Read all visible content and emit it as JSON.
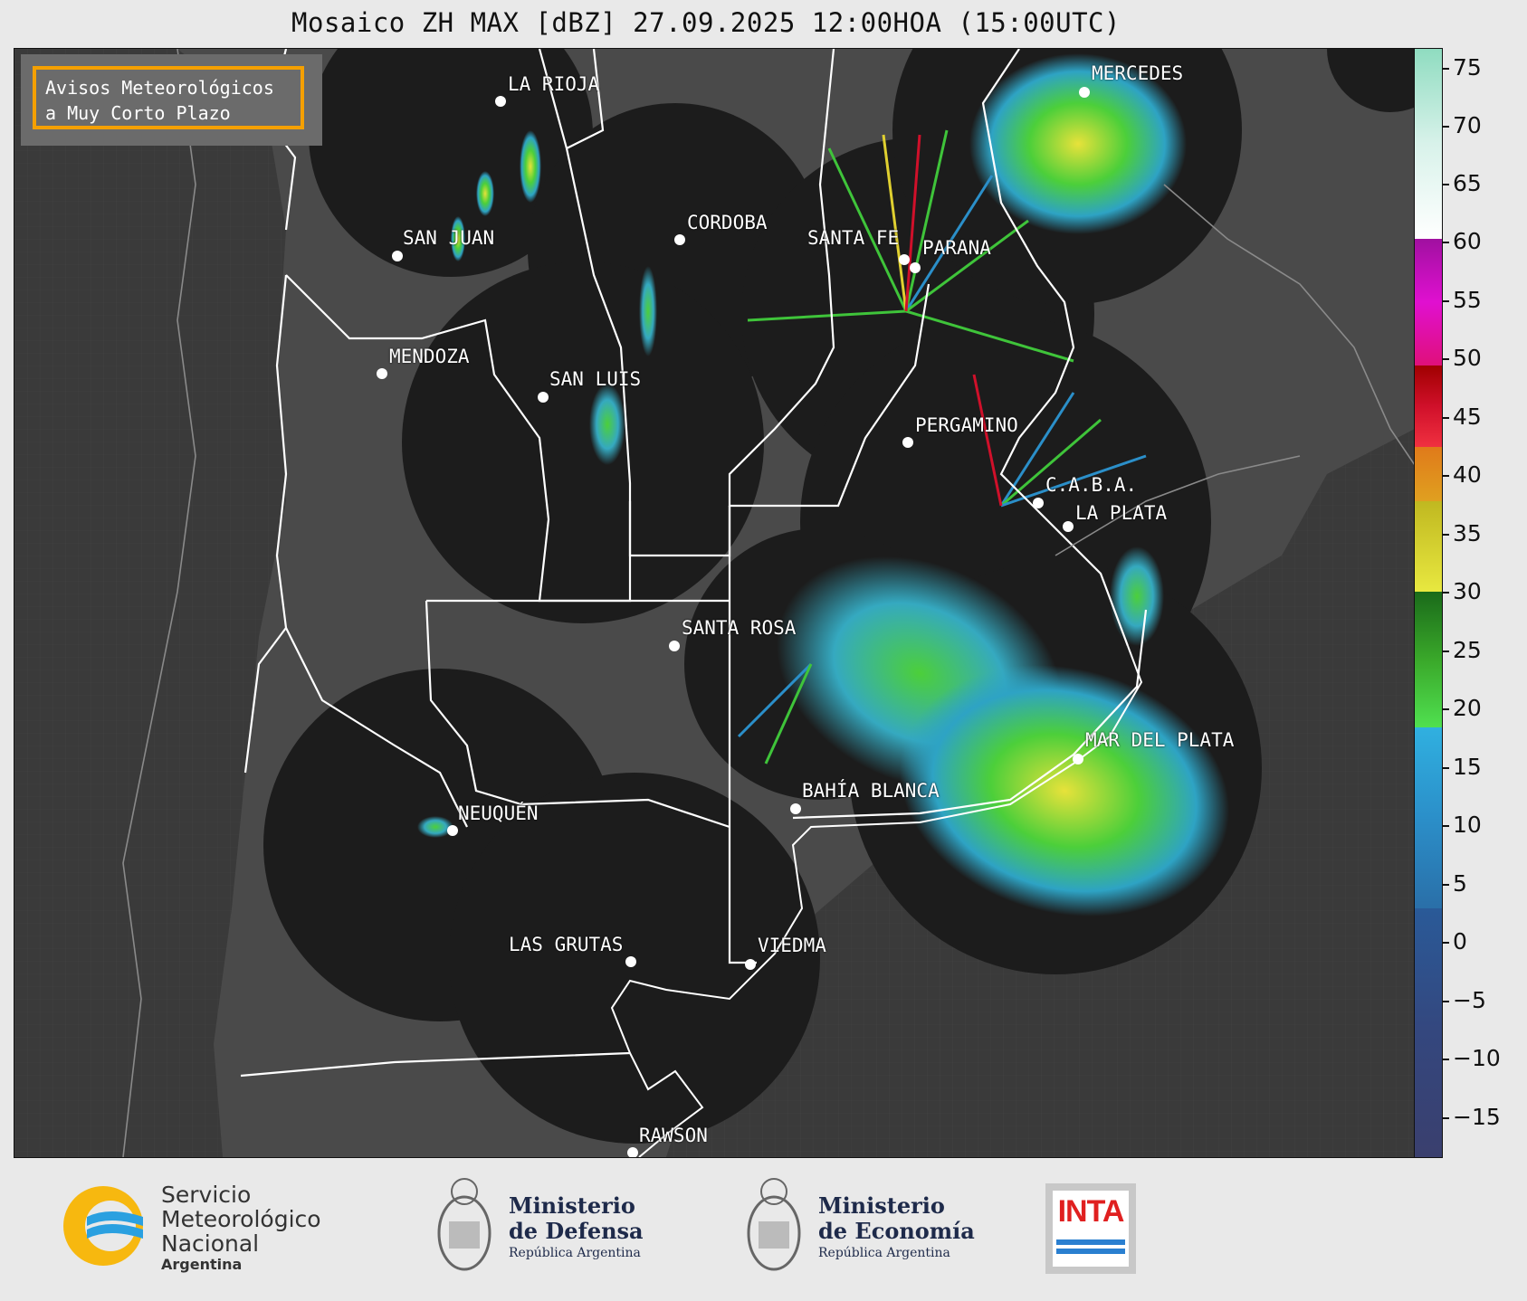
{
  "title": "Mosaico ZH MAX [dBZ] 27.09.2025 12:00HOA (15:00UTC)",
  "notice": {
    "line1": "Avisos Meteorológicos",
    "line2": "a Muy Corto Plazo"
  },
  "cities": [
    {
      "id": "la-rioja",
      "name": "LA RIOJA"
    },
    {
      "id": "cordoba",
      "name": "CORDOBA"
    },
    {
      "id": "san-juan",
      "name": "SAN JUAN"
    },
    {
      "id": "santa-fe",
      "name": "SANTA FE"
    },
    {
      "id": "parana",
      "name": "PARANA"
    },
    {
      "id": "mercedes",
      "name": "MERCEDES"
    },
    {
      "id": "mendoza",
      "name": "MENDOZA"
    },
    {
      "id": "san-luis",
      "name": "SAN LUIS"
    },
    {
      "id": "pergamino",
      "name": "PERGAMINO"
    },
    {
      "id": "caba",
      "name": "C.A.B.A."
    },
    {
      "id": "la-plata",
      "name": "LA PLATA"
    },
    {
      "id": "santa-rosa",
      "name": "SANTA ROSA"
    },
    {
      "id": "mar-del-plata",
      "name": "MAR DEL PLATA"
    },
    {
      "id": "bahia-blanca",
      "name": "BAHÍA BLANCA"
    },
    {
      "id": "neuquen",
      "name": "NEUQUÉN"
    },
    {
      "id": "las-grutas",
      "name": "LAS GRUTAS"
    },
    {
      "id": "viedma",
      "name": "VIEDMA"
    },
    {
      "id": "rawson",
      "name": "RAWSON"
    }
  ],
  "colorbar": {
    "ticks": [
      "75",
      "70",
      "65",
      "60",
      "55",
      "50",
      "45",
      "40",
      "35",
      "30",
      "25",
      "20",
      "15",
      "10",
      "5",
      "0",
      "−5",
      "−10",
      "−15"
    ],
    "colors": {
      "low": "#3a3f6e",
      "blue": "#2b8fc9",
      "green": "#3fc43a",
      "yellow": "#d8d23a",
      "orange": "#e08a1a",
      "red": "#d0102a",
      "magenta": "#e010d0",
      "teal": "#8fdcc0"
    }
  },
  "logos": {
    "smn": {
      "line1": "Servicio",
      "line2": "Meteorológico",
      "line3": "Nacional",
      "line4": "Argentina"
    },
    "defensa": {
      "line1": "Ministerio",
      "line2": "de Defensa",
      "line3": "República Argentina"
    },
    "economia": {
      "line1": "Ministerio",
      "line2": "de Economía",
      "line3": "República Argentina"
    },
    "inta": {
      "text": "INTA"
    }
  }
}
